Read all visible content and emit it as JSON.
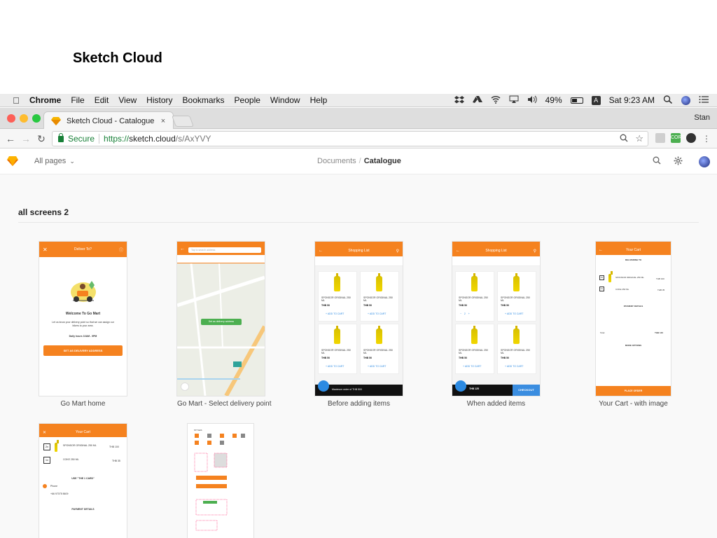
{
  "slide_title": "Sketch Cloud",
  "menubar": {
    "app": "Chrome",
    "items": [
      "File",
      "Edit",
      "View",
      "History",
      "Bookmarks",
      "People",
      "Window",
      "Help"
    ],
    "battery": "49%",
    "input_badge": "A",
    "clock": "Sat 9:23 AM"
  },
  "browser": {
    "tab_title": "Sketch Cloud - Catalogue",
    "tab_close": "×",
    "profile": "Stan",
    "secure_label": "Secure",
    "url_scheme": "https://",
    "url_host": "sketch.cloud",
    "url_path": "/s/AxYVY",
    "ext_label": "CORS"
  },
  "app": {
    "pages_label": "All pages",
    "crumb_documents": "Documents",
    "crumb_separator": "/",
    "crumb_current": "Catalogue",
    "section_title": "all screens 2"
  },
  "artboards": [
    {
      "caption": "Go Mart home",
      "header": "Deliver To?",
      "welcome": "Welcome To Go Mart",
      "body": "Let us know your delivery point so that we can assign our bikers to your area.",
      "hours": "Daily hours 10AM - 9PM",
      "cta": "SET AS DELIVERY ADDRESS"
    },
    {
      "caption": "Go Mart - Select delivery point",
      "search_placeholder": "Tap to search address",
      "pin_label": "Set as delivery address"
    },
    {
      "caption": "Before adding items",
      "header": "Shopping List",
      "product": "SPONSOR ORIGINAL 250 ML",
      "price": "THB 50",
      "add": "+ ADD TO CART",
      "footer": "Maximum order of THB 500"
    },
    {
      "caption": "When added items",
      "header": "Shopping List",
      "product": "SPONSOR ORIGINAL 250 ML",
      "price": "THB 50",
      "add": "+ ADD TO CART",
      "footer_total": "THB 125",
      "checkout": "CHECKOUT"
    },
    {
      "caption": "Your Cart - with image",
      "header": "Your Cart",
      "delivering_to": "DELIVERING TO",
      "item1": "SPONSOR ORIGINAL 250 ML",
      "item1_price": "THB 100",
      "qty1": "2x",
      "item2": "COKE 250 ML",
      "item2_price": "THB 35",
      "qty2": "1x",
      "payment_details": "PAYMENT DETAILS",
      "total": "Total",
      "total_value": "THB 140",
      "more_options": "MORE OPTIONS",
      "cta": "PLACE ORDER"
    },
    {
      "header": "Your Cart",
      "item1": "SPONSOR ORIGINAL 250 ML",
      "item1_price": "THB 100",
      "qty1": "2x",
      "item2": "COKE 250 ML",
      "item2_price": "THB 35",
      "qty2": "1x",
      "use_cash": "USE \"THE 1 CARD\"",
      "phone_label": "Phone",
      "phone": "+66 97075 5609",
      "payment_details": "PAYMENT DETAILS"
    },
    {
      "label": "STYLES"
    }
  ],
  "colors": {
    "accent": "#f5821f",
    "link": "#2c8ae2",
    "secure": "#188038",
    "checkout": "#3a8de0"
  }
}
